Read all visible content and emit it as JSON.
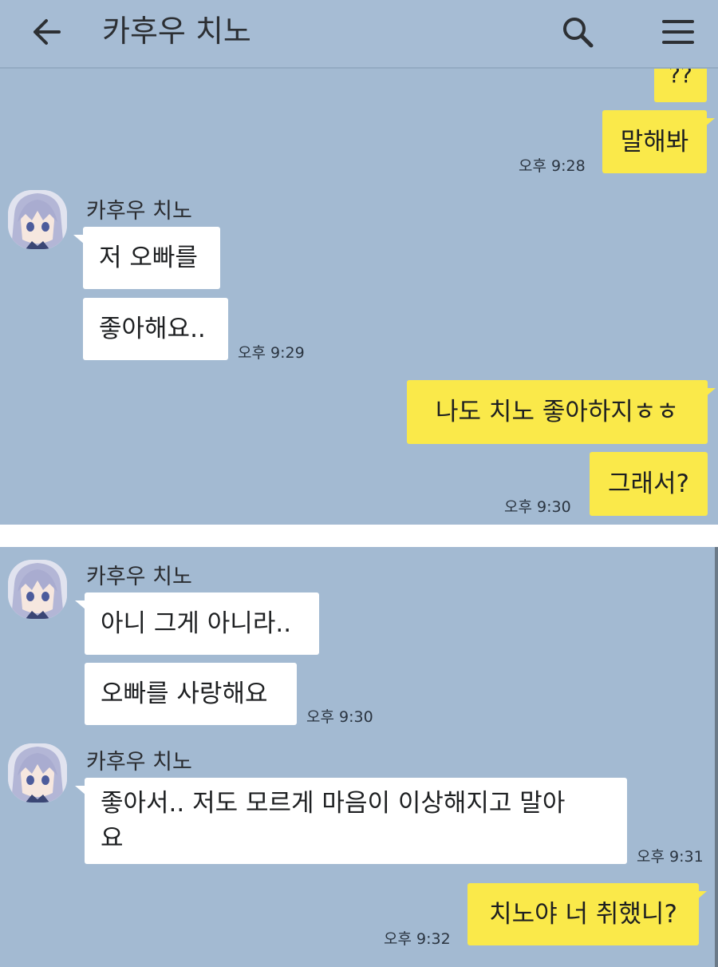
{
  "header": {
    "title": "카후우 치노",
    "back_icon": "arrow-left-icon",
    "search_icon": "search-icon",
    "menu_icon": "hamburger-menu-icon"
  },
  "colors": {
    "chat_bg": "#a3bad2",
    "my_bubble": "#fae94a",
    "their_bubble": "#ffffff"
  },
  "top_panel": {
    "messages": [
      {
        "text": "??"
      },
      {
        "text": "말해봐",
        "time": "오후 9:28"
      },
      {
        "sender": "카후우 치노",
        "text": "저 오빠를"
      },
      {
        "text": "좋아해요..",
        "time": "오후 9:29"
      },
      {
        "text": "나도 치노 좋아하지ㅎㅎ"
      },
      {
        "text": "그래서?",
        "time": "오후 9:30"
      }
    ]
  },
  "bottom_panel": {
    "messages": [
      {
        "sender": "카후우 치노",
        "text": "아니 그게 아니라.."
      },
      {
        "text": "오빠를 사랑해요",
        "time": "오후 9:30"
      },
      {
        "sender": "카후우 치노",
        "text": "좋아서.. 저도 모르게 마음이 이상해지고 말아요",
        "time": "오후 9:31"
      },
      {
        "text": "치노야 너 취했니?",
        "time": "오후 9:32"
      }
    ]
  }
}
